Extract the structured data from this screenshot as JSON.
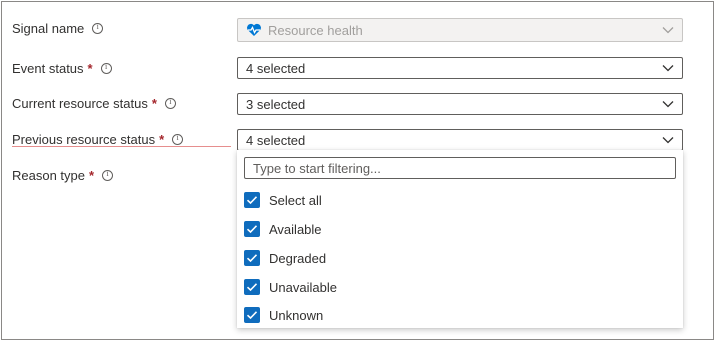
{
  "form": {
    "signal_name": {
      "label": "Signal name",
      "value": "Resource health",
      "icon": "heart-pulse-icon"
    },
    "event_status": {
      "label": "Event status",
      "required": "*",
      "value": "4 selected"
    },
    "current_resource_status": {
      "label": "Current resource status",
      "required": "*",
      "value": "3 selected"
    },
    "previous_resource_status": {
      "label": "Previous resource status",
      "required": "*",
      "value": "4 selected"
    },
    "reason_type": {
      "label": "Reason type",
      "required": "*"
    }
  },
  "dropdown_panel": {
    "filter_placeholder": "Type to start filtering...",
    "options": [
      {
        "label": "Select all",
        "checked": true
      },
      {
        "label": "Available",
        "checked": true
      },
      {
        "label": "Degraded",
        "checked": true
      },
      {
        "label": "Unavailable",
        "checked": true
      },
      {
        "label": "Unknown",
        "checked": true
      }
    ]
  },
  "colors": {
    "accent": "#0f6cbd",
    "required": "#a4262c",
    "error_underline": "#e68e8e",
    "heart": "#0078d4"
  }
}
